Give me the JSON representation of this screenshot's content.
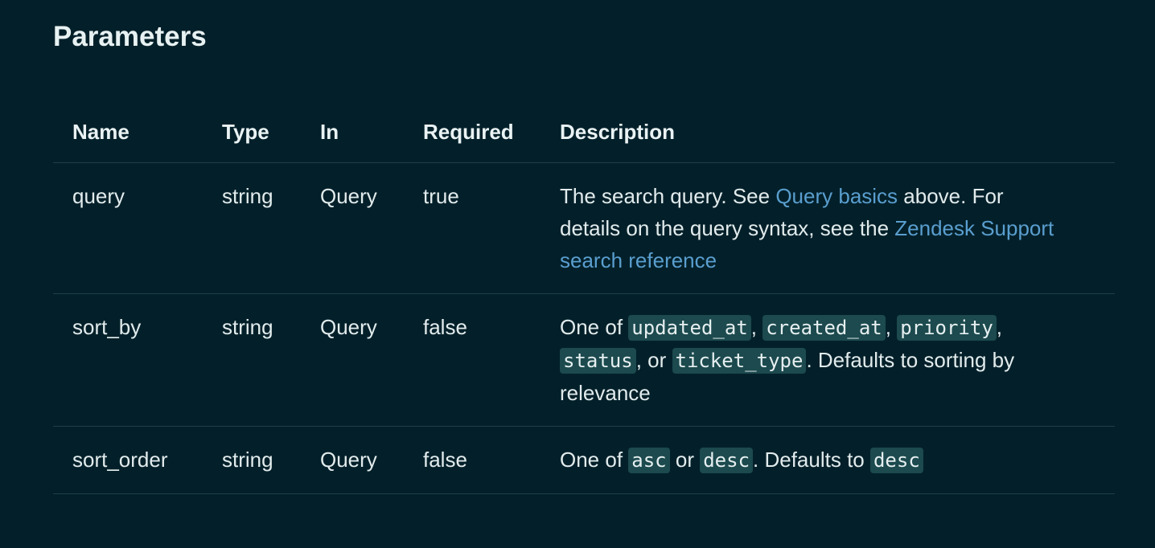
{
  "section": {
    "title": "Parameters"
  },
  "table": {
    "headers": {
      "name": "Name",
      "type": "Type",
      "in": "In",
      "required": "Required",
      "description": "Description"
    },
    "rows": [
      {
        "name": "query",
        "type": "string",
        "in": "Query",
        "required": "true",
        "desc": {
          "t1": "The search query. See ",
          "link1": "Query basics",
          "t2": " above. For details on the query syntax, see the ",
          "link2": "Zendesk Support search reference"
        }
      },
      {
        "name": "sort_by",
        "type": "string",
        "in": "Query",
        "required": "false",
        "desc": {
          "t1": "One of ",
          "c1": "updated_at",
          "t2": ", ",
          "c2": "created_at",
          "t3": ", ",
          "c3": "priority",
          "t4": ", ",
          "c4": "status",
          "t5": ", or ",
          "c5": "ticket_type",
          "t6": ". Defaults to sorting by relevance"
        }
      },
      {
        "name": "sort_order",
        "type": "string",
        "in": "Query",
        "required": "false",
        "desc": {
          "t1": "One of ",
          "c1": "asc",
          "t2": " or ",
          "c2": "desc",
          "t3": ". Defaults to ",
          "c3": "desc"
        }
      }
    ]
  },
  "colors": {
    "background": "#03202A",
    "link": "#5A9ECF",
    "code_background": "#1C4A4E",
    "divider": "#1E3E47"
  }
}
